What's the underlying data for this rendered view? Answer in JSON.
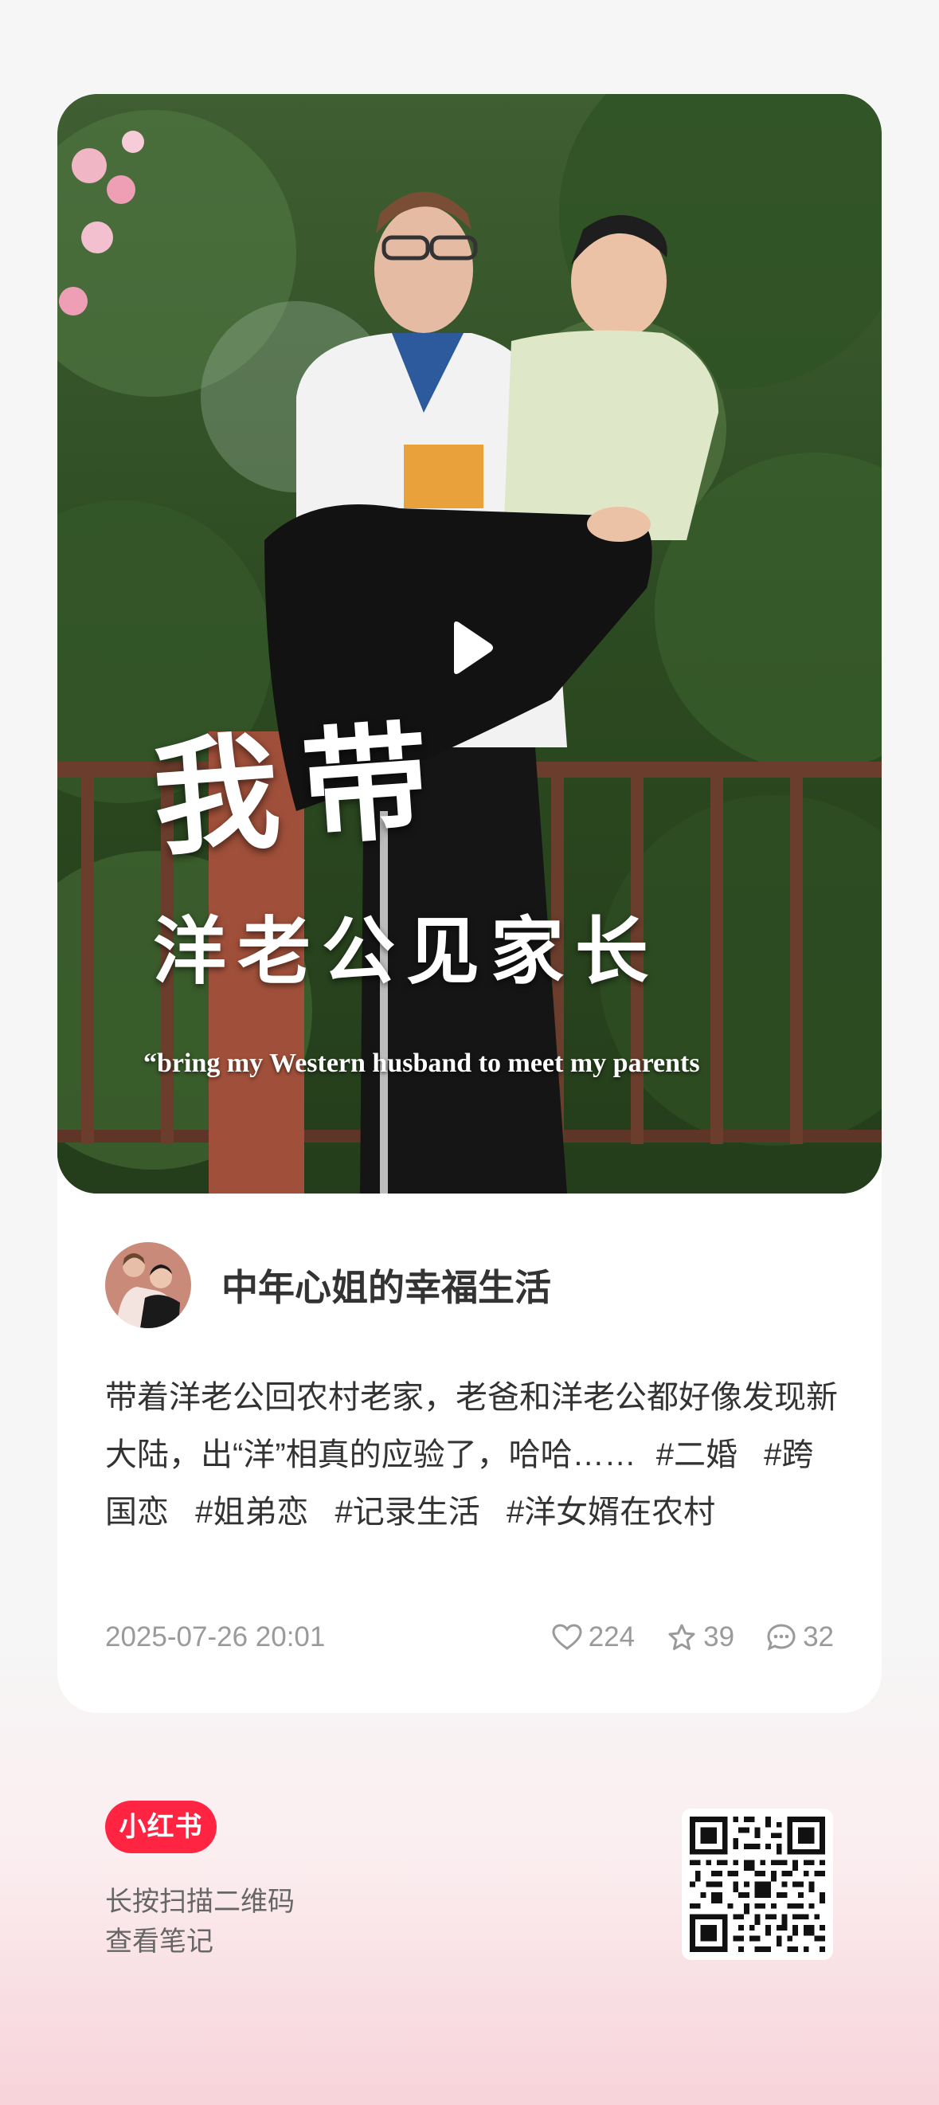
{
  "post": {
    "cover": {
      "title_line1": "我带",
      "title_line2": "洋老公见家长",
      "title_en": "“bring my Western husband to meet my parents"
    },
    "author": {
      "name": "中年心姐的幸福生活"
    },
    "description": "带着洋老公回农村老家，老爸和洋老公都好像发现新大陆，出“洋”相真的应验了，哈哈……",
    "tags": [
      "#二婚",
      "#跨国恋",
      "#姐弟恋",
      "#记录生活",
      "#洋女婿在农村"
    ],
    "date": "2025-07-26 20:01",
    "stats": {
      "likes": "224",
      "collects": "39",
      "comments": "32"
    }
  },
  "footer": {
    "logo": "小红书",
    "hint_line1": "长按扫描二维码",
    "hint_line2": "查看笔记"
  },
  "colors": {
    "brand": "#ff2442",
    "text_primary": "#333333",
    "text_secondary": "#9a9a9a"
  },
  "icons": [
    "play-icon",
    "heart-icon",
    "star-icon",
    "comment-icon",
    "qr-code"
  ]
}
